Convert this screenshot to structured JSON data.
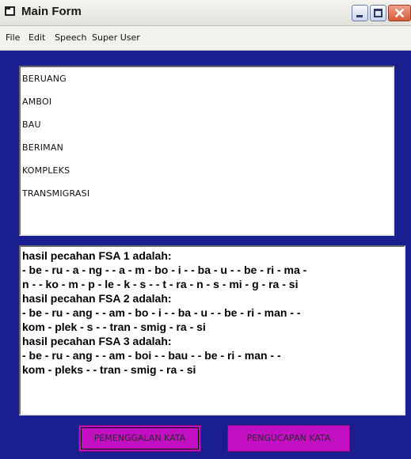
{
  "window": {
    "title": "Main Form"
  },
  "menu": [
    "File",
    "Edit",
    "Speech",
    "Super User"
  ],
  "word_list": [
    "BERUANG",
    "AMBOI",
    "BAU",
    "BERIMAN",
    "KOMPLEKS",
    "TRANSMIGRASI"
  ],
  "output_lines": [
    "hasil pecahan FSA 1 adalah:",
    "- be - ru - a - ng -  - a - m - bo - i -  - ba - u -  - be - ri - ma -",
    "n -  - ko - m - p - le - k - s -  - t - ra - n - s - mi - g - ra - si",
    "hasil pecahan FSA 2 adalah:",
    "- be - ru - ang -  - am - bo - i -  - ba - u -  - be - ri - man -  -",
    "kom - plek - s -  - tran - smig - ra - si",
    "hasil pecahan FSA 3 adalah:",
    "- be - ru - ang -  - am - boi -  - bau -  - be - ri - man -  -",
    "kom - pleks -  - tran - smig - ra - si"
  ],
  "buttons": {
    "pemenggalan": "PEMENGGALAN KATA",
    "pengucapan": "PENGUCAPAN KATA"
  },
  "colors": {
    "form_background": "#1a1f8f",
    "button_background": "#c20fc2"
  }
}
